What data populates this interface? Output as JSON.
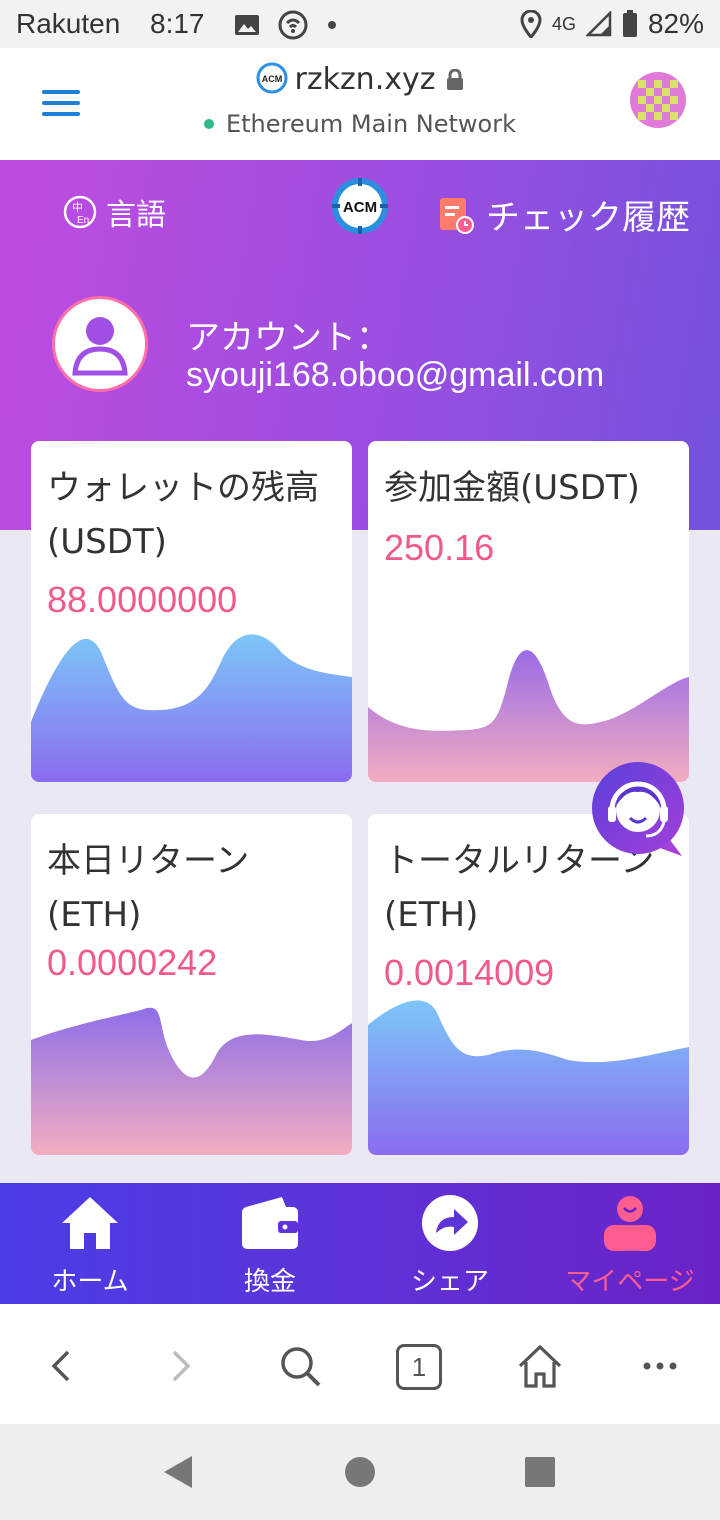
{
  "status_bar": {
    "carrier": "Rakuten",
    "time": "8:17",
    "network": "4G",
    "battery": "82%"
  },
  "browser": {
    "site": "rzkzn.xyz",
    "network_name": "Ethereum Main Network",
    "tab_count": "1"
  },
  "hero": {
    "language_label": "言語",
    "history_label": "チェック履歴",
    "account_label": "アカウント：",
    "account_email": "syouji168.oboo@gmail.com"
  },
  "cards": [
    {
      "title": "ウォレットの残高(USDT)",
      "value": "88.0000000"
    },
    {
      "title": "参加金額(USDT)",
      "value": "250.16"
    },
    {
      "title": "本日リターン(ETH)",
      "value": "0.0000242"
    },
    {
      "title": "トータルリターン(ETH)",
      "value": "0.0014009"
    }
  ],
  "nav": {
    "home": "ホーム",
    "exchange": "換金",
    "share": "シェア",
    "mypage": "マイページ",
    "active": "mypage"
  },
  "colors": {
    "accent_pink": "#f05a8a",
    "hero_start": "#c04be0",
    "hero_end": "#7452dd",
    "nav_active": "#ff5d8f"
  }
}
